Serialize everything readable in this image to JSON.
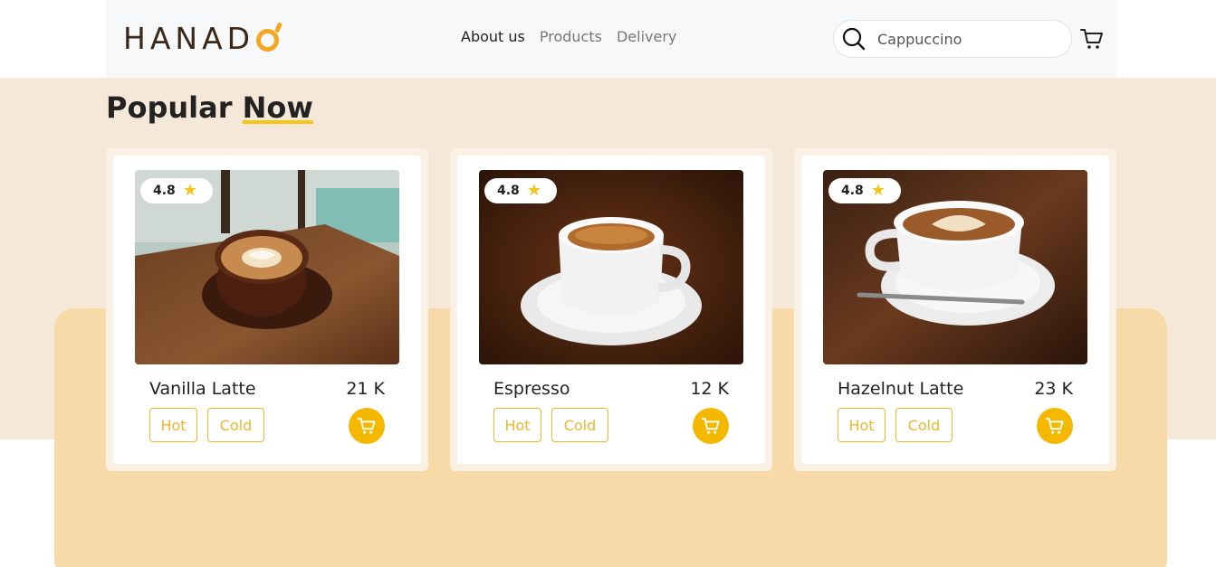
{
  "brand": {
    "logo_text": "HANAD",
    "accent_color": "#f5a623"
  },
  "nav": {
    "links": [
      "About us",
      "Products",
      "Delivery"
    ],
    "active_index": 0
  },
  "search": {
    "value": "Cappuccino",
    "icon": "search-icon"
  },
  "nav_cart": {
    "icon": "cart-icon"
  },
  "section": {
    "title_plain": "Popular",
    "title_accent": "Now"
  },
  "products": [
    {
      "name": "Vanilla Latte",
      "price": "21 K",
      "rating": "4.8",
      "tags": [
        "Hot",
        "Cold"
      ],
      "image": "latte-art-cup-on-wooden-table"
    },
    {
      "name": "Espresso",
      "price": "12 K",
      "rating": "4.8",
      "tags": [
        "Hot",
        "Cold"
      ],
      "image": "white-espresso-cup-on-saucer"
    },
    {
      "name": "Hazelnut Latte",
      "price": "23 K",
      "rating": "4.8",
      "tags": [
        "Hot",
        "Cold"
      ],
      "image": "latte-cup-with-spoon-on-saucer"
    }
  ],
  "colors": {
    "page_band": "#f5e8d8",
    "panel": "#f8d9a8",
    "button_yellow": "#f5b800",
    "tag_border": "#f0b429"
  }
}
